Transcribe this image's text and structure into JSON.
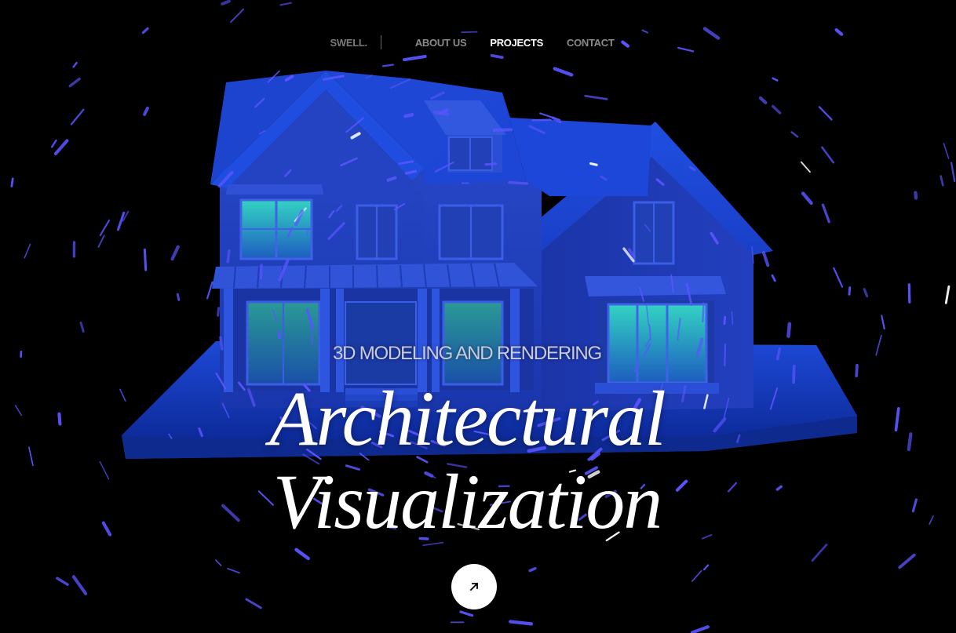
{
  "nav": {
    "brand": "SWELL.",
    "links": [
      {
        "label": "ABOUT US",
        "active": false
      },
      {
        "label": "PROJECTS",
        "active": true
      },
      {
        "label": "CONTACT",
        "active": false
      }
    ]
  },
  "hero": {
    "eyebrow": "3D MODELING AND RENDERING",
    "title_line1": "Architectural",
    "title_line2": "Visualization",
    "cta_icon": "arrow-up-right-icon"
  },
  "colors": {
    "background": "#000000",
    "house_blue": "#1e40c8",
    "window_glow": "#2fb79a",
    "streak_blue": "#5a55ff",
    "streak_white": "#ffffff"
  }
}
